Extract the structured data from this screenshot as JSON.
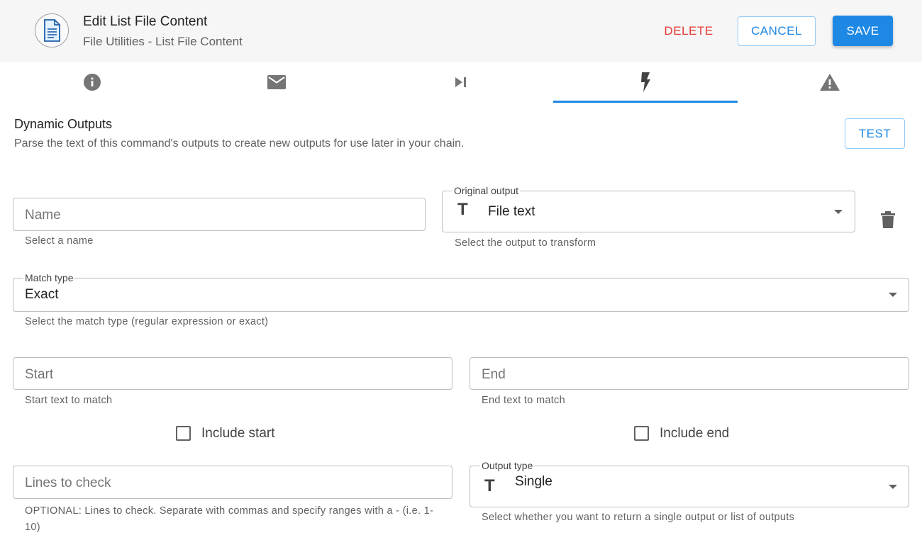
{
  "header": {
    "title": "Edit List File Content",
    "subtitle": "File Utilities - List File Content",
    "delete_label": "DELETE",
    "cancel_label": "CANCEL",
    "save_label": "SAVE"
  },
  "tabs": [
    {
      "icon": "info-icon",
      "active": false
    },
    {
      "icon": "mail-icon",
      "active": false
    },
    {
      "icon": "skip-next-icon",
      "active": false
    },
    {
      "icon": "flash-icon",
      "active": true
    },
    {
      "icon": "warning-icon",
      "active": false
    }
  ],
  "section": {
    "title": "Dynamic Outputs",
    "description": "Parse the text of this command's outputs to create new outputs for use later in your chain.",
    "test_label": "TEST"
  },
  "form": {
    "name": {
      "placeholder": "Name",
      "helper": "Select a name"
    },
    "original_output": {
      "legend": "Original output",
      "value": "File text",
      "helper": "Select the output to transform"
    },
    "match_type": {
      "legend": "Match type",
      "value": "Exact",
      "helper": "Select the match type (regular expression or exact)"
    },
    "start": {
      "placeholder": "Start",
      "helper": "Start text to match"
    },
    "end": {
      "placeholder": "End",
      "helper": "End text to match"
    },
    "include_start": {
      "label": "Include start",
      "checked": false
    },
    "include_end": {
      "label": "Include end",
      "checked": false
    },
    "lines": {
      "placeholder": "Lines to check",
      "helper": "OPTIONAL: Lines to check. Separate with commas and specify ranges with a - (i.e. 1-10)"
    },
    "output_type": {
      "legend": "Output type",
      "value": "Single",
      "helper": "Select whether you want to return a single output or list of outputs"
    }
  },
  "colors": {
    "accent": "#1e88e5",
    "danger": "#e53935"
  }
}
